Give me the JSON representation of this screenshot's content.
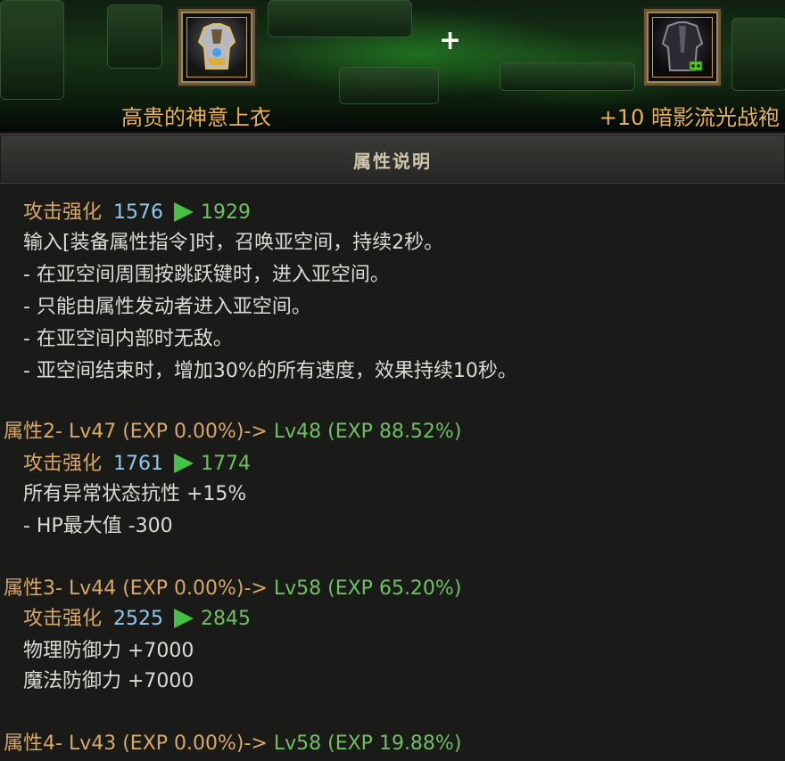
{
  "compare": {
    "left_item_name": "高贵的神意上衣",
    "plus_symbol": "+",
    "right_item_name": "+10 暗影流光战袍"
  },
  "header": {
    "title": "属性说明"
  },
  "sections": {
    "attr1": {
      "stat_label": "攻击强化",
      "old_value": "1576",
      "new_value": "1929",
      "desc": [
        "输入[装备属性指令]时，召唤亚空间，持续2秒。",
        "- 在亚空间周围按跳跃键时，进入亚空间。",
        "- 只能由属性发动者进入亚空间。",
        "- 在亚空间内部时无敌。",
        "- 亚空间结束时，增加30%的所有速度，效果持续10秒。"
      ]
    },
    "attr2": {
      "prefix": "属性",
      "level_text": "2- Lv47 (EXP 0.00%)->",
      "new_level_text": " Lv48 (EXP 88.52%)",
      "stat_label": "攻击强化",
      "old_value": "1761",
      "new_value": "1774",
      "lines": [
        "所有异常状态抗性 +15%",
        "- HP最大值 -300"
      ]
    },
    "attr3": {
      "prefix": "属性",
      "level_text": "3- Lv44 (EXP 0.00%)->",
      "new_level_text": " Lv58 (EXP 65.20%)",
      "stat_label": "攻击强化",
      "old_value": "2525",
      "new_value": "2845",
      "lines": [
        "物理防御力 +7000",
        "魔法防御力 +7000"
      ]
    },
    "attr4": {
      "prefix": "属性",
      "level_text": "4- Lv43 (EXP 0.00%)->",
      "new_level_text": " Lv58 (EXP 19.88%)"
    }
  },
  "colors": {
    "gold": "#d8a868",
    "blue": "#8ec8ee",
    "green": "#6ec060",
    "arrow": "#46c046"
  },
  "icons": [
    "noble-tunic-icon",
    "shadow-robe-icon",
    "green-arrow-icon"
  ]
}
